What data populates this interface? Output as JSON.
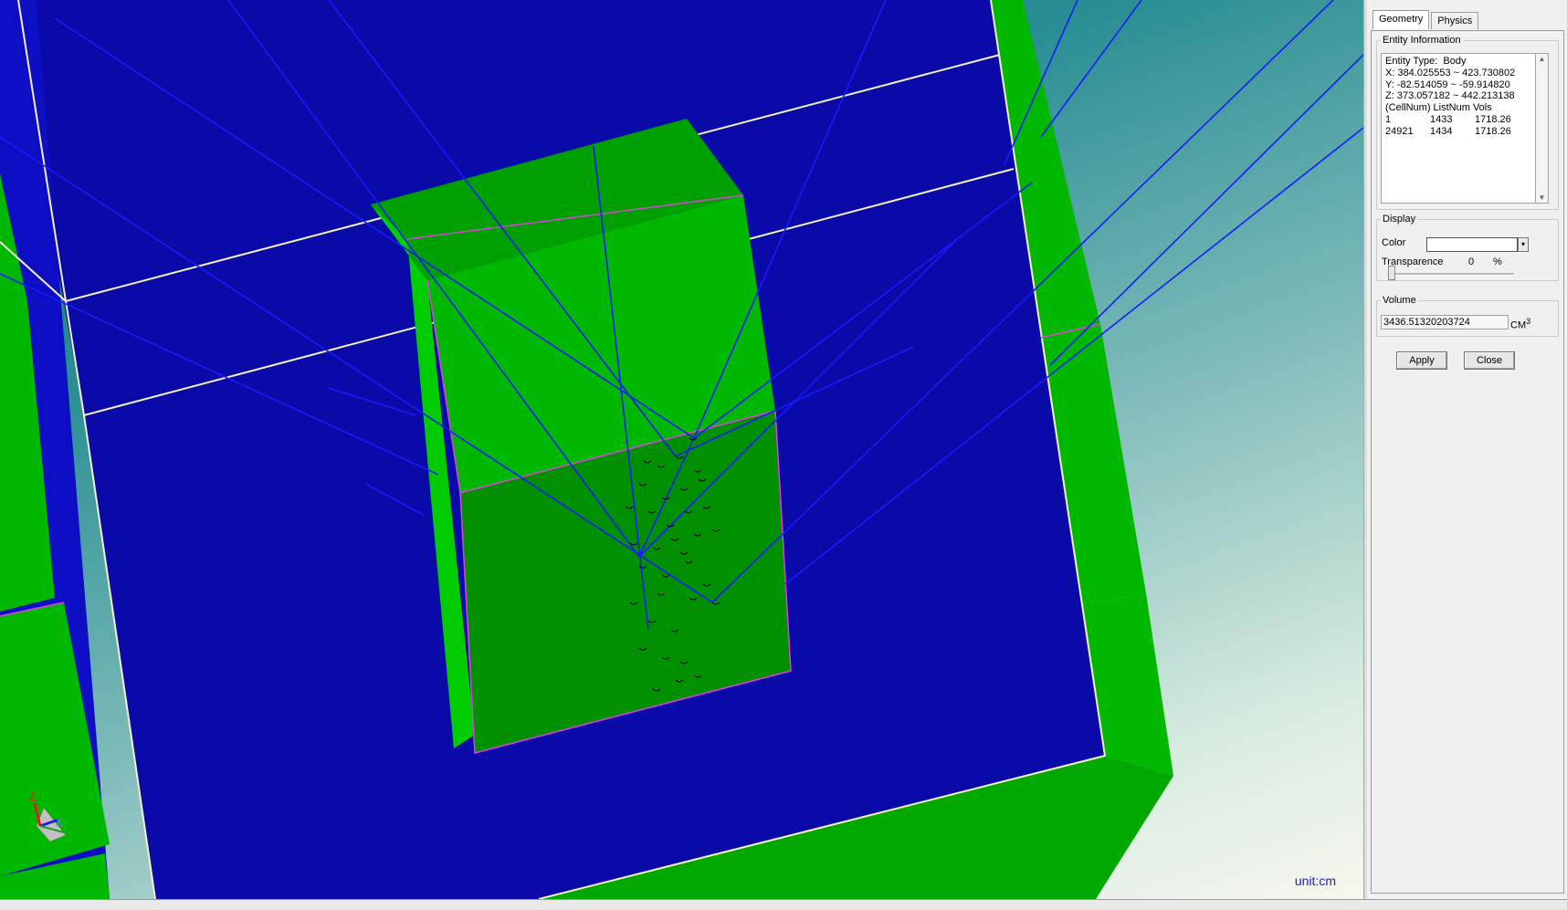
{
  "viewport": {
    "unit_label": "unit:cm",
    "axes": {
      "z": "Z",
      "x": "X",
      "y": "Y"
    },
    "colors": {
      "body_fill": "#0a0aa8",
      "block_green": "#00b800",
      "block_bright_green": "#00cc00",
      "block_dark_green": "#008c00",
      "ray": "#1a1aff",
      "edge_magenta": "#e040e0",
      "edge_white": "#f4f0c8"
    }
  },
  "panel": {
    "tabs": [
      {
        "label": "Geometry",
        "active": true
      },
      {
        "label": "Physics",
        "active": false
      }
    ],
    "entity_info": {
      "legend": "Entity Information",
      "entity_type": "Entity Type:  Body",
      "x_range": "X: 384.025553 ~ 423.730802",
      "y_range": "Y: -82.514059 ~ -59.914820",
      "z_range": "Z: 373.057182 ~ 442.213138",
      "header": "(CellNum) ListNum Vols",
      "rows": [
        {
          "cell": "1",
          "list": "1433",
          "vol": "1718.26"
        },
        {
          "cell": "24921",
          "list": "1434",
          "vol": "1718.26"
        }
      ]
    },
    "display": {
      "legend": "Display",
      "color_label": "Color",
      "color_value": "#ffffff",
      "transparence_label": "Transparence",
      "transparence_value": "0",
      "transparence_unit": "%"
    },
    "volume": {
      "legend": "Volume",
      "value": "3436.51320203724",
      "unit": "CM",
      "unit_exp": "3"
    },
    "buttons": {
      "apply": "Apply",
      "close": "Close"
    }
  }
}
